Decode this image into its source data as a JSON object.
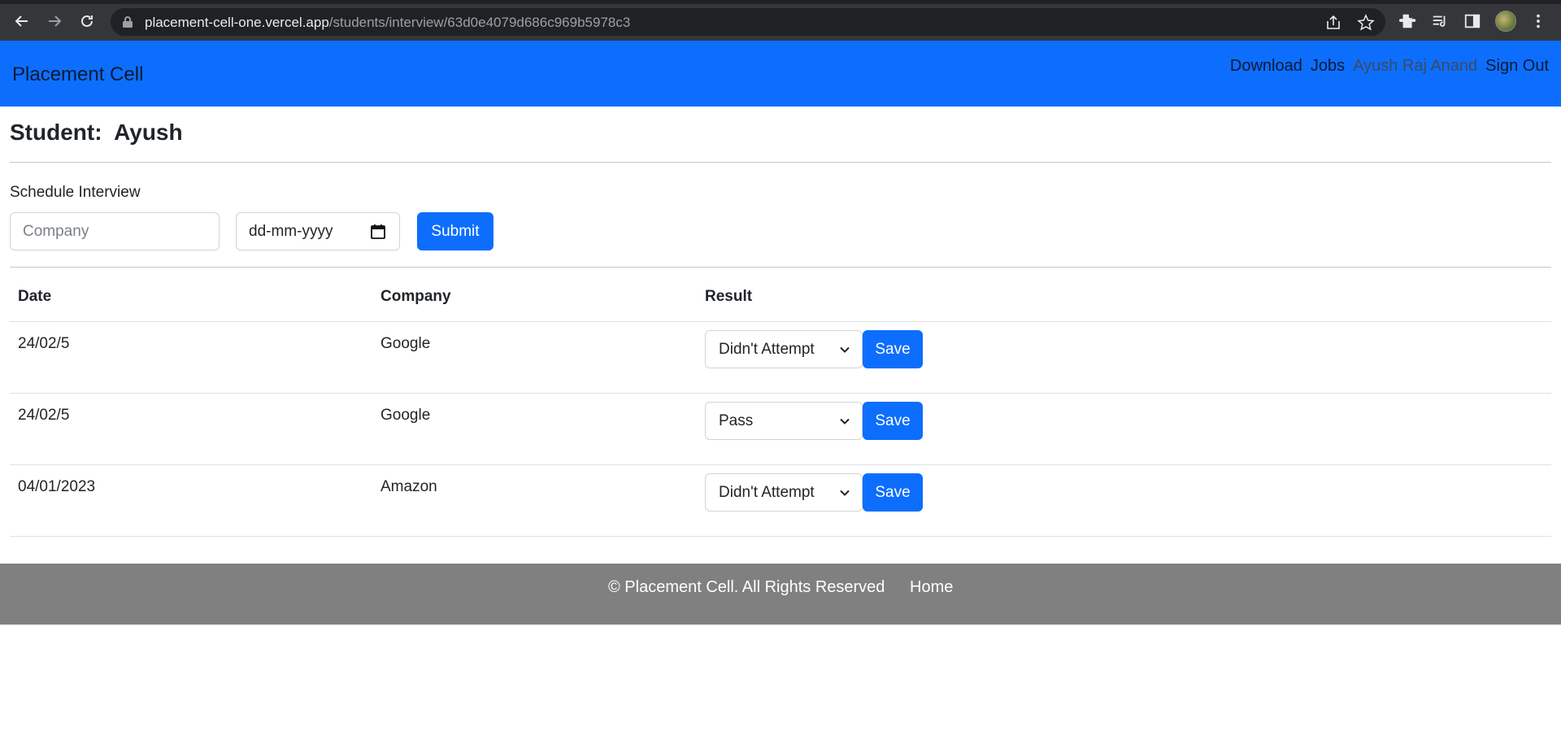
{
  "browser": {
    "url_host": "placement-cell-one.vercel.app",
    "url_path": "/students/interview/63d0e4079d686c969b5978c3"
  },
  "navbar": {
    "brand": "Placement Cell",
    "links": [
      "Download",
      "Jobs",
      "Ayush Raj Anand",
      "Sign Out"
    ]
  },
  "student": {
    "label": "Student:",
    "name": "Ayush"
  },
  "schedule": {
    "label": "Schedule Interview",
    "company_placeholder": "Company",
    "date_placeholder": "dd-mm-yyyy",
    "submit_label": "Submit"
  },
  "table": {
    "headers": [
      "Date",
      "Company",
      "Result"
    ],
    "rows": [
      {
        "date": "24/02/5",
        "company": "Google",
        "result": "Didn't Attempt",
        "save": "Save"
      },
      {
        "date": "24/02/5",
        "company": "Google",
        "result": "Pass",
        "save": "Save"
      },
      {
        "date": "04/01/2023",
        "company": "Amazon",
        "result": "Didn't Attempt",
        "save": "Save"
      }
    ]
  },
  "footer": {
    "text": "© Placement Cell. All Rights Reserved",
    "home": "Home"
  },
  "colors": {
    "primary": "#0d6efd",
    "footer_bg": "#808080",
    "chrome_bg": "#35363a"
  }
}
